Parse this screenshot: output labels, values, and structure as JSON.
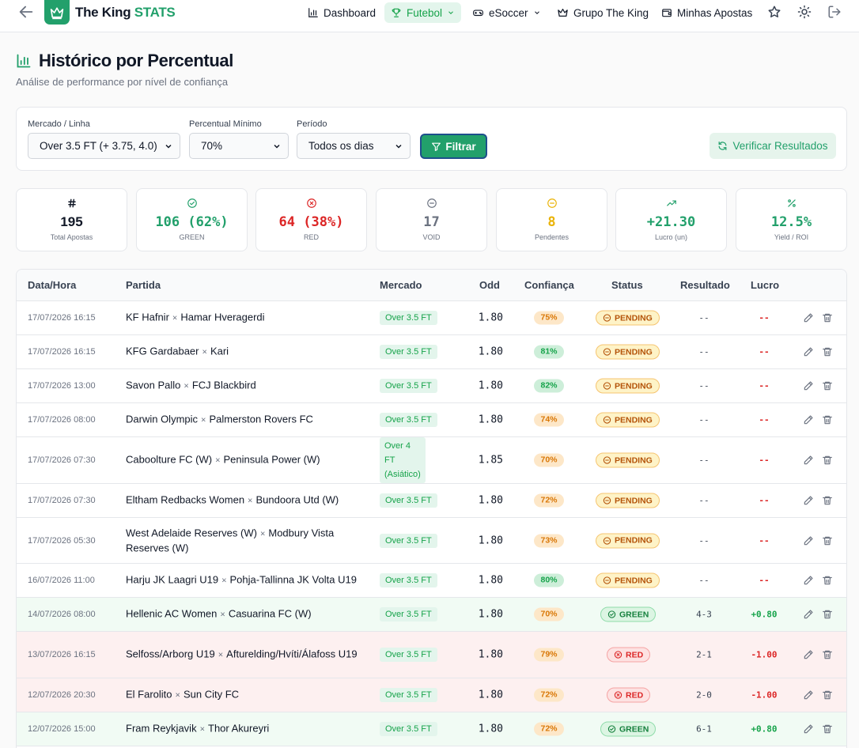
{
  "header": {
    "brand_main": "The King",
    "brand_accent": "STATS",
    "nav": [
      {
        "label": "Dashboard",
        "icon": "bar-chart-icon"
      },
      {
        "label": "Futebol",
        "icon": "trophy-icon",
        "active": true
      },
      {
        "label": "eSoccer",
        "icon": "gamepad-icon"
      },
      {
        "label": "Grupo The King",
        "icon": "crown-icon"
      },
      {
        "label": "Minhas Apostas",
        "icon": "wallet-icon"
      }
    ]
  },
  "page": {
    "title": "Histórico por Percentual",
    "subtitle": "Análise de performance por nível de confiança"
  },
  "filters": {
    "market_label": "Mercado / Linha",
    "market_value": "Over 3.5 FT (+ 3.75, 4.0)",
    "min_pct_label": "Percentual Mínimo",
    "min_pct_value": "70%",
    "period_label": "Período",
    "period_value": "Todos os dias",
    "filter_button": "Filtrar",
    "verify_button": "Verificar Resultados"
  },
  "stats": [
    {
      "value": "195",
      "label": "Total Apostas",
      "color": "#111827",
      "icon": "hash-icon"
    },
    {
      "value": "106 (62%)",
      "label": "GREEN",
      "color": "#22a06b",
      "icon": "check-circle-icon"
    },
    {
      "value": "64 (38%)",
      "label": "RED",
      "color": "#dc2626",
      "icon": "x-circle-icon"
    },
    {
      "value": "17",
      "label": "VOID",
      "color": "#6b7280",
      "icon": "minus-circle-icon"
    },
    {
      "value": "8",
      "label": "Pendentes",
      "color": "#eab308",
      "icon": "pending-circle-icon"
    },
    {
      "value": "+21.30",
      "label": "Lucro (un)",
      "color": "#22a06b",
      "icon": "trending-up-icon"
    },
    {
      "value": "12.5%",
      "label": "Yield / ROI",
      "color": "#22a06b",
      "icon": "percent-icon"
    }
  ],
  "table": {
    "headers": [
      "Data/Hora",
      "Partida",
      "Mercado",
      "Odd",
      "Confiança",
      "Status",
      "Resultado",
      "Lucro"
    ],
    "rows": [
      {
        "date": "17/07/2026 16:15",
        "home": "KF Hafnir",
        "away": "Hamar Hveragerdi",
        "market": "Over 3.5 FT",
        "odd": "1.80",
        "conf": "75%",
        "status": "PENDING",
        "result": "--",
        "profit": "--"
      },
      {
        "date": "17/07/2026 16:15",
        "home": "KFG Gardabaer",
        "away": "Kari",
        "market": "Over 3.5 FT",
        "odd": "1.80",
        "conf": "81%",
        "status": "PENDING",
        "result": "--",
        "profit": "--"
      },
      {
        "date": "17/07/2026 13:00",
        "home": "Savon Pallo",
        "away": "FCJ Blackbird",
        "market": "Over 3.5 FT",
        "odd": "1.80",
        "conf": "82%",
        "status": "PENDING",
        "result": "--",
        "profit": "--"
      },
      {
        "date": "17/07/2026 08:00",
        "home": "Darwin Olympic",
        "away": "Palmerston Rovers FC",
        "market": "Over 3.5 FT",
        "odd": "1.80",
        "conf": "74%",
        "status": "PENDING",
        "result": "--",
        "profit": "--"
      },
      {
        "date": "17/07/2026 07:30",
        "home": "Caboolture FC (W)",
        "away": "Peninsula Power (W)",
        "market": "Over 4 FT (Asiático)",
        "odd": "1.85",
        "conf": "70%",
        "status": "PENDING",
        "result": "--",
        "profit": "--"
      },
      {
        "date": "17/07/2026 07:30",
        "home": "Eltham Redbacks Women",
        "away": "Bundoora Utd (W)",
        "market": "Over 3.5 FT",
        "odd": "1.80",
        "conf": "72%",
        "status": "PENDING",
        "result": "--",
        "profit": "--"
      },
      {
        "date": "17/07/2026 05:30",
        "home": "West Adelaide Reserves (W)",
        "away": "Modbury Vista Reserves (W)",
        "market": "Over 3.5 FT",
        "odd": "1.80",
        "conf": "73%",
        "status": "PENDING",
        "result": "--",
        "profit": "--"
      },
      {
        "date": "16/07/2026 11:00",
        "home": "Harju JK Laagri U19",
        "away": "Pohja-Tallinna JK Volta U19",
        "market": "Over 3.5 FT",
        "odd": "1.80",
        "conf": "80%",
        "status": "PENDING",
        "result": "--",
        "profit": "--"
      },
      {
        "date": "14/07/2026 08:00",
        "home": "Hellenic AC Women",
        "away": "Casuarina FC (W)",
        "market": "Over 3.5 FT",
        "odd": "1.80",
        "conf": "70%",
        "status": "GREEN",
        "result": "4-3",
        "profit": "+0.80"
      },
      {
        "date": "13/07/2026 16:15",
        "home": "Selfoss/Arborg U19",
        "away": "Afturelding/Hvíti/Álafoss U19",
        "market": "Over 3.5 FT",
        "odd": "1.80",
        "conf": "79%",
        "status": "RED",
        "result": "2-1",
        "profit": "-1.00"
      },
      {
        "date": "12/07/2026 20:30",
        "home": "El Farolito",
        "away": "Sun City FC",
        "market": "Over 3.5 FT",
        "odd": "1.80",
        "conf": "72%",
        "status": "RED",
        "result": "2-0",
        "profit": "-1.00"
      },
      {
        "date": "12/07/2026 15:00",
        "home": "Fram Reykjavik",
        "away": "Thor Akureyri",
        "market": "Over 3.5 FT",
        "odd": "1.80",
        "conf": "72%",
        "status": "GREEN",
        "result": "6-1",
        "profit": "+0.80"
      }
    ]
  }
}
